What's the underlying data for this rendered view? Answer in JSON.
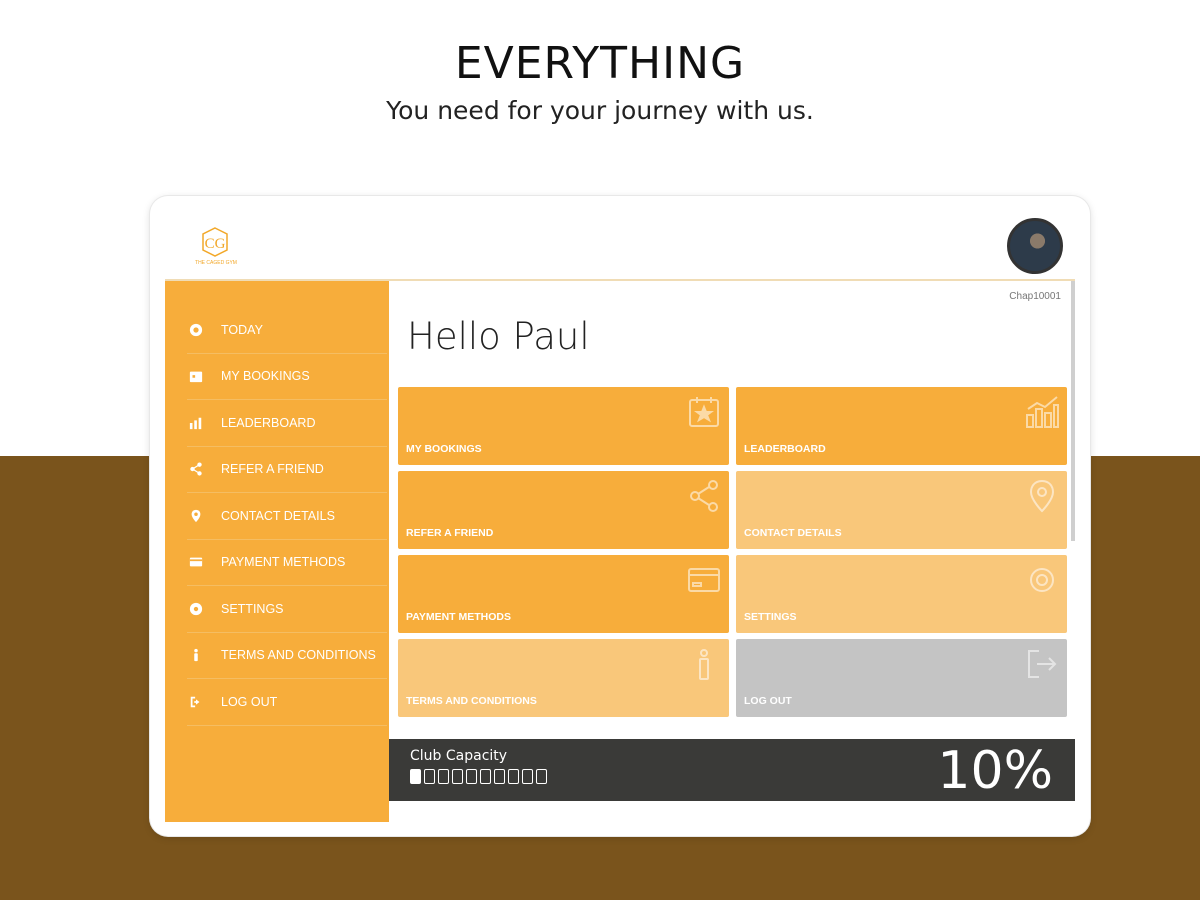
{
  "hero": {
    "title": "EVERYTHING",
    "subtitle": "You need for your journey with us."
  },
  "app": {
    "logo_text": "CG",
    "logo_caption": "THE CAGED GYM",
    "user_code": "Chap10001",
    "greeting": "Hello Paul"
  },
  "sidebar": {
    "items": [
      {
        "label": "TODAY",
        "icon": "globe-icon"
      },
      {
        "label": "MY BOOKINGS",
        "icon": "calendar-icon"
      },
      {
        "label": "LEADERBOARD",
        "icon": "chart-icon"
      },
      {
        "label": "REFER A FRIEND",
        "icon": "share-icon"
      },
      {
        "label": "CONTACT DETAILS",
        "icon": "location-pin-icon"
      },
      {
        "label": "PAYMENT METHODS",
        "icon": "credit-card-icon"
      },
      {
        "label": "SETTINGS",
        "icon": "gear-icon"
      },
      {
        "label": "TERMS AND CONDITIONS",
        "icon": "info-icon"
      },
      {
        "label": "LOG OUT",
        "icon": "logout-icon"
      }
    ]
  },
  "tiles": [
    {
      "label": "MY BOOKINGS",
      "icon": "calendar-star-icon",
      "color": "#f7ad3b"
    },
    {
      "label": "LEADERBOARD",
      "icon": "bar-chart-icon",
      "color": "#f7ad3b"
    },
    {
      "label": "REFER A FRIEND",
      "icon": "share-icon",
      "color": "#f7ad3b"
    },
    {
      "label": "CONTACT DETAILS",
      "icon": "location-pin-icon",
      "color": "#f9c77a"
    },
    {
      "label": "PAYMENT METHODS",
      "icon": "credit-card-icon",
      "color": "#f7ad3b"
    },
    {
      "label": "SETTINGS",
      "icon": "gear-icon",
      "color": "#f9c77a"
    },
    {
      "label": "TERMS AND CONDITIONS",
      "icon": "info-icon",
      "color": "#f9c77a"
    },
    {
      "label": "LOG OUT",
      "icon": "logout-icon",
      "color": "#c4c4c4"
    }
  ],
  "capacity": {
    "label": "Club Capacity",
    "value_text": "10%",
    "fraction": 0.1,
    "segments": 10
  },
  "colors": {
    "accent": "#f7ad3b",
    "brown": "#7a541c",
    "dark_bar": "#3a3a38"
  }
}
